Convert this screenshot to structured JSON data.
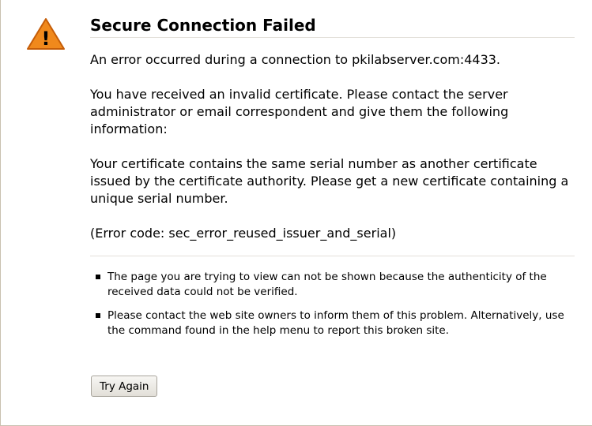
{
  "error_page": {
    "title": "Secure Connection Failed",
    "icon": "warning-icon",
    "icon_glyph": "!",
    "colors": {
      "icon_fill": "#f0891c",
      "icon_stroke": "#c55d08",
      "divider": "#e3e0da",
      "page_border": "#c9c1b0"
    },
    "description": {
      "connection_error": "An error occurred during a connection to pkilabserver.com:4433.",
      "invalid_certificate": "You have received an invalid certificate.  Please contact the server administrator or email correspondent and give them the following information:",
      "serial_conflict": "Your certificate contains the same serial number as another certificate issued by the certificate authority.  Please get a new certificate containing a unique serial number.",
      "error_code": "(Error code: sec_error_reused_issuer_and_serial)"
    },
    "help_items": [
      "The page you are trying to view can not be shown because the authenticity of the received data could not be verified.",
      "Please contact the web site owners to inform them of this problem. Alternatively, use the command found in the help menu to report this broken site."
    ],
    "try_again_label": "Try Again"
  }
}
